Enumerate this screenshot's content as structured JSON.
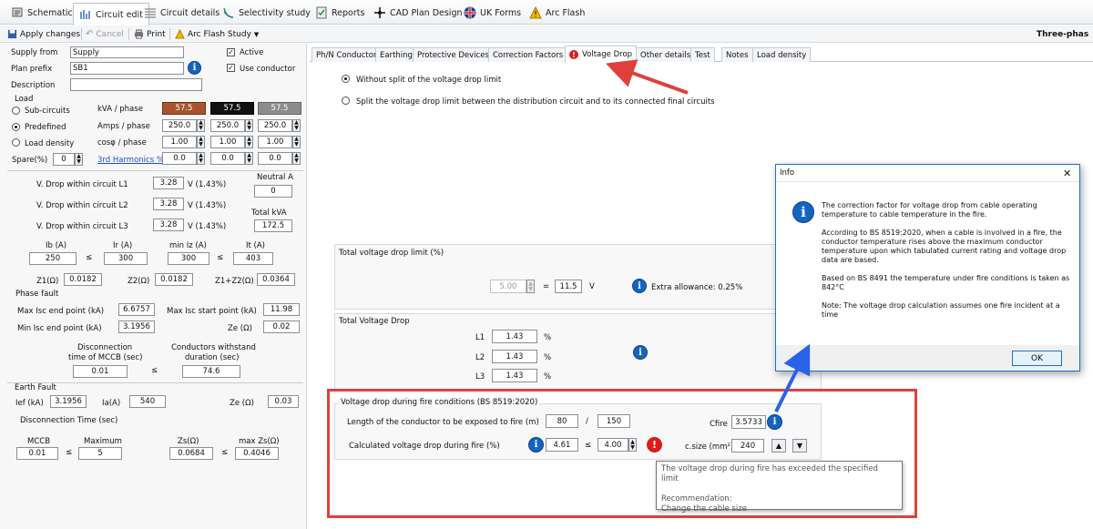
{
  "main_tabs": [
    {
      "label": "Schematic"
    },
    {
      "label": "Circuit edit"
    },
    {
      "label": "Circuit details"
    },
    {
      "label": "Selectivity study"
    },
    {
      "label": "Reports"
    },
    {
      "label": "CAD Plan Design"
    },
    {
      "label": "UK Forms"
    },
    {
      "label": "Arc Flash"
    }
  ],
  "toolbar": {
    "apply": "Apply changes",
    "cancel": "Cancel",
    "print": "Print",
    "arc_flash": "Arc Flash Study",
    "right_title": "Three-phas"
  },
  "left": {
    "supply_from_label": "Supply from",
    "supply_from_value": "Supply",
    "plan_prefix_label": "Plan prefix",
    "plan_prefix_value": "SB1",
    "description_label": "Description",
    "description_value": "",
    "active_label": "Active",
    "use_conductor_label": "Use conductor",
    "load_title": "Load",
    "sub_circuits": "Sub-circuits",
    "predefined": "Predefined",
    "load_density": "Load density",
    "spare_label": "Spare(%)",
    "spare_value": "0",
    "kva_label": "kVA / phase",
    "kva_values": [
      "57.5",
      "57.5",
      "57.5"
    ],
    "amps_label": "Amps / phase",
    "amps_values": [
      "250.0",
      "250.0",
      "250.0"
    ],
    "cos_label": "cosφ / phase",
    "cos_values": [
      "1.00",
      "1.00",
      "1.00"
    ],
    "harmonics_label": "3rd Harmonics %",
    "harmonics_values": [
      "0.0",
      "0.0",
      "0.0"
    ],
    "vd_l1_label": "V. Drop within circuit L1",
    "vd_l1_value": "3.28",
    "vd_l1_unit": "V (1.43%)",
    "vd_l2_label": "V. Drop within circuit L2",
    "vd_l2_value": "3.28",
    "vd_l2_unit": "V (1.43%)",
    "vd_l3_label": "V. Drop within circuit L3",
    "vd_l3_value": "3.28",
    "vd_l3_unit": "V (1.43%)",
    "neutral_label": "Neutral A",
    "neutral_value": "0",
    "total_kva_label": "Total kVA",
    "total_kva_value": "172.5",
    "ib_label": "Ib (A)",
    "ib_value": "250",
    "ir_label": "Ir (A)",
    "ir_value": "300",
    "miniz_label": "min Iz (A)",
    "miniz_value": "300",
    "it_label": "It (A)",
    "it_value": "403",
    "le": "≤",
    "z1_label": "Z1(Ω)",
    "z1_value": "0.0182",
    "z2_label": "Z2(Ω)",
    "z2_value": "0.0182",
    "z12_label": "Z1+Z2(Ω)",
    "z12_value": "0.0364",
    "phase_fault_title": "Phase fault",
    "max_isc_end_label": "Max Isc end point (kA)",
    "max_isc_end_value": "6.6757",
    "max_isc_start_label": "Max Isc start point (kA)",
    "max_isc_start_value": "11.98",
    "min_isc_end_label": "Min Isc end point (kA)",
    "min_isc_end_value": "3.1956",
    "ze_label": "Ze (Ω)",
    "ze_value": "0.02",
    "disc_time_label1": "Disconnection",
    "disc_time_label2": "time of MCCB (sec)",
    "disc_time_value": "0.01",
    "withstand_label1": "Conductors withstand",
    "withstand_label2": "duration (sec)",
    "withstand_value": "74.6",
    "earth_fault_title": "Earth Fault",
    "ief_label": "Ief (kA)",
    "ief_value": "3.1956",
    "ia_label": "Ia(A)",
    "ia_value": "540",
    "ze2_label": "Ze (Ω)",
    "ze2_value": "0.03",
    "disc_time_sec_label": "Disconnection Time (sec)",
    "mccb_label": "MCCB",
    "mccb_value": "0.01",
    "maximum_label": "Maximum",
    "maximum_value": "5",
    "zs_label": "Zs(Ω)",
    "zs_value": "0.0684",
    "maxzs_label": "max Zs(Ω)",
    "maxzs_value": "0.4046"
  },
  "right_tabs": [
    {
      "label": "Ph/N Conductor"
    },
    {
      "label": "Earthing"
    },
    {
      "label": "Protective Devices"
    },
    {
      "label": "Correction Factors"
    },
    {
      "label": "Voltage Drop"
    },
    {
      "label": "Other details"
    },
    {
      "label": "Test"
    },
    {
      "label": "Notes"
    },
    {
      "label": "Load density"
    }
  ],
  "vd": {
    "opt_without": "Without split of the voltage drop limit",
    "opt_split": "Split the voltage drop limit between the distribution circuit and to its connected final circuits",
    "limit_title": "Total voltage drop limit (%)",
    "limit_value": "5.00",
    "equals": "=",
    "limit_volts": "11.5",
    "volts_unit": "V",
    "extra_allowance": "Extra allowance: 0.25%",
    "total_title": "Total Voltage Drop",
    "l1_label": "L1",
    "l1_value": "1.43",
    "l2_label": "L2",
    "l2_value": "1.43",
    "l3_label": "L3",
    "l3_value": "1.43",
    "pct": "%",
    "fire_title": "Voltage drop during fire conditions (BS 8519:2020)",
    "length_label": "Length of the conductor to be exposed to fire (m)",
    "length_value": "80",
    "slash": "/",
    "length_total": "150",
    "calc_label": "Calculated voltage drop during fire (%)",
    "calc_value": "4.61",
    "le": "≤",
    "calc_limit": "4.00",
    "cfire_label": "Cfire",
    "cfire_value": "3.5733",
    "csize_label": "c.size (mm²)",
    "csize_value": "240"
  },
  "dialog": {
    "title": "Info",
    "close": "✕",
    "p1": "The correction factor for voltage drop from cable operating temperature to cable temperature in the fire.",
    "p2": "According to BS 8519:2020, when a cable is involved in a fire, the conductor temperature rises above the maximum conductor temperature upon which tabulated current rating and voltage drop data are based.",
    "p3": "Based on BS 8491 the temperature under fire conditions is taken as 842°C",
    "p4": "Note: The voltage drop calculation assumes one fire incident at a time",
    "ok": "OK"
  },
  "tooltip": {
    "line1": "The voltage drop during fire has exceeded the specified limit",
    "line2": "Recommendation:",
    "line3": "Change the cable size"
  },
  "colors": {
    "kva_box1": "#a8552f",
    "kva_box2": "#111111",
    "kva_box3": "#8c8c8c",
    "highlight_red": "#e0403c",
    "arrow_blue": "#2a62e8",
    "info_blue": "#1565c0"
  }
}
